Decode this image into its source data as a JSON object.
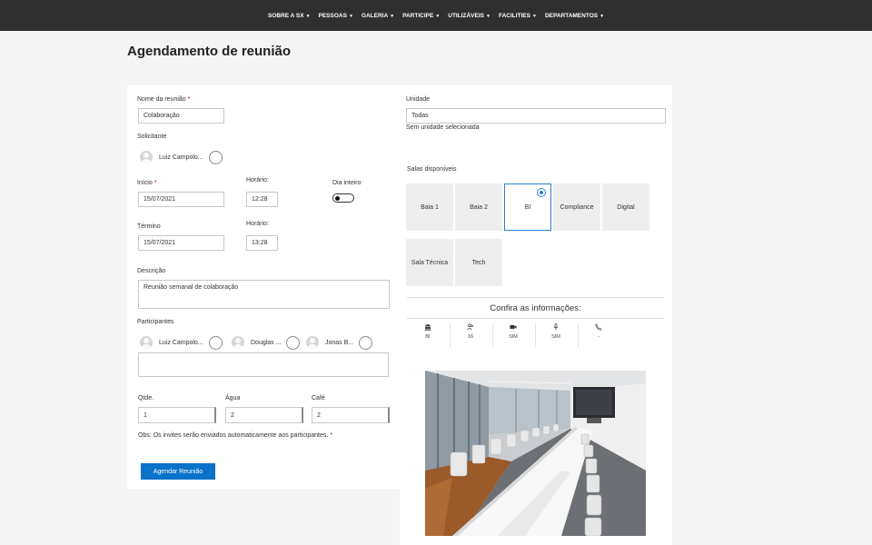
{
  "nav": {
    "items": [
      {
        "label": "SOBRE A SX"
      },
      {
        "label": "PESSOAS"
      },
      {
        "label": "GALERIA"
      },
      {
        "label": "PARTICIPE"
      },
      {
        "label": "UTILIZÁVEIS"
      },
      {
        "label": "FACILITIES"
      },
      {
        "label": "DEPARTAMENTOS"
      }
    ]
  },
  "page": {
    "title": "Agendamento de reunião"
  },
  "form": {
    "meeting_name_label": "Nome da reunião",
    "meeting_name_value": "Colaboração",
    "required_mark": "*",
    "requester_label": "Solicitante",
    "requester_name": "Luiz Campolo...",
    "start_label": "Início",
    "start_date": "15/07/2021",
    "start_time_label": "Horário:",
    "start_time": "12:28",
    "all_day_label": "Dia inteiro",
    "end_label": "Término",
    "end_date": "15/07/2021",
    "end_time_label": "Horário:",
    "end_time": "13:28",
    "description_label": "Descrição",
    "description_value": "Reunião semanal de colaboração",
    "participants_label": "Participantes",
    "participants": [
      {
        "name": "Luiz Campolo..."
      },
      {
        "name": "Douglas ..."
      },
      {
        "name": "Jonas B..."
      }
    ],
    "qty_label": "Qtde.",
    "qty_value": "1",
    "water_label": "Água",
    "water_value": "2",
    "coffee_label": "Café",
    "coffee_value": "2",
    "note": "Obs: Os invites serão enviados automaticamente aos participantes. *",
    "submit_label": "Agendar Reunião"
  },
  "right": {
    "unit_label": "Unidade",
    "unit_value": "Todas",
    "unit_hint": "Sem unidade selecionada",
    "rooms_label": "Salas disponíveis",
    "rooms": [
      {
        "label": "Baia 1",
        "selected": false
      },
      {
        "label": "Baia 2",
        "selected": false
      },
      {
        "label": "BI",
        "selected": true
      },
      {
        "label": "Compliance",
        "selected": false
      },
      {
        "label": "Digital",
        "selected": false
      },
      {
        "label": "Sala Técnica",
        "selected": false
      },
      {
        "label": "Tech",
        "selected": false
      }
    ],
    "confirm_title": "Confira as informações:",
    "info": [
      {
        "icon": "building-icon",
        "value": "BI"
      },
      {
        "icon": "people-icon",
        "value": "16"
      },
      {
        "icon": "camera-icon",
        "value": "SIM"
      },
      {
        "icon": "microphone-icon",
        "value": "SIM"
      },
      {
        "icon": "phone-icon",
        "value": "-"
      }
    ]
  },
  "colors": {
    "nav_bg": "#2f2f2f",
    "accent": "#0a72c9",
    "selected_border": "#2a7fd6"
  }
}
